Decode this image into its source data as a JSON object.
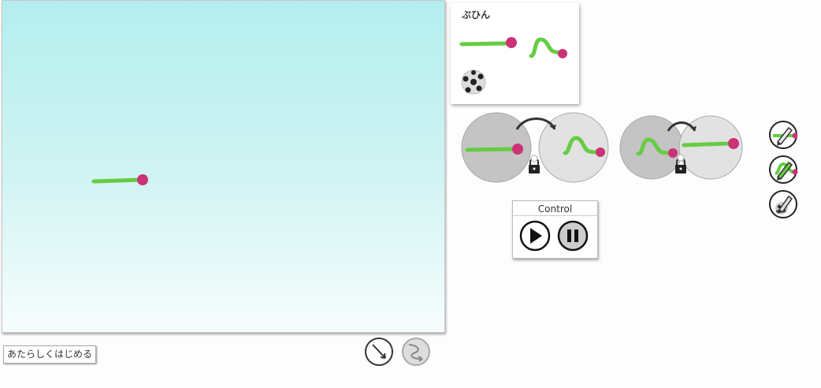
{
  "stage": {
    "placed_parts": [
      "line-part"
    ]
  },
  "buttons": {
    "reset_label": "あたらしくはじめる"
  },
  "tools": [
    {
      "name": "line-tool",
      "active": true
    },
    {
      "name": "curve-tool",
      "active": false
    }
  ],
  "parts_panel": {
    "title": "ぶひん",
    "parts": [
      "line-part",
      "wave-part",
      "soccer-ball-part"
    ]
  },
  "rules": [
    {
      "from": "line-part",
      "to": "wave-part",
      "locked": true
    },
    {
      "from": "wave-part",
      "to": "line-part",
      "locked": true
    }
  ],
  "control": {
    "title": "Control",
    "play_state": "stopped"
  },
  "edit_tools": [
    "edit-line-icon",
    "edit-wave-icon",
    "edit-ball-icon"
  ],
  "colors": {
    "line_green": "#66cc44",
    "dot_magenta": "#cc3377",
    "stage_top": "#b3eeee",
    "stage_bottom": "#f7fdfd"
  }
}
